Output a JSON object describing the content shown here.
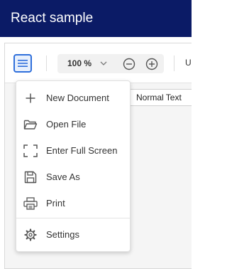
{
  "app": {
    "title": "React sample"
  },
  "toolbar": {
    "zoom_value": "100 %",
    "truncated_label": "U",
    "paragraph_style": "Normal Text"
  },
  "icons": {
    "menu": "hamburger-icon",
    "zoom_dropdown": "chevron-down-icon",
    "zoom_out": "minus-circle-icon",
    "zoom_in": "plus-circle-icon"
  },
  "menu": {
    "items": [
      {
        "label": "New Document",
        "icon": "plus-icon"
      },
      {
        "label": "Open File",
        "icon": "folder-icon"
      },
      {
        "label": "Enter Full Screen",
        "icon": "fullscreen-icon"
      },
      {
        "label": "Save As",
        "icon": "save-icon"
      },
      {
        "label": "Print",
        "icon": "printer-icon"
      },
      {
        "label": "Settings",
        "icon": "gear-icon"
      }
    ]
  },
  "colors": {
    "appbar": "#0b1b66",
    "accent": "#2f6fdb",
    "icon": "#555555"
  }
}
